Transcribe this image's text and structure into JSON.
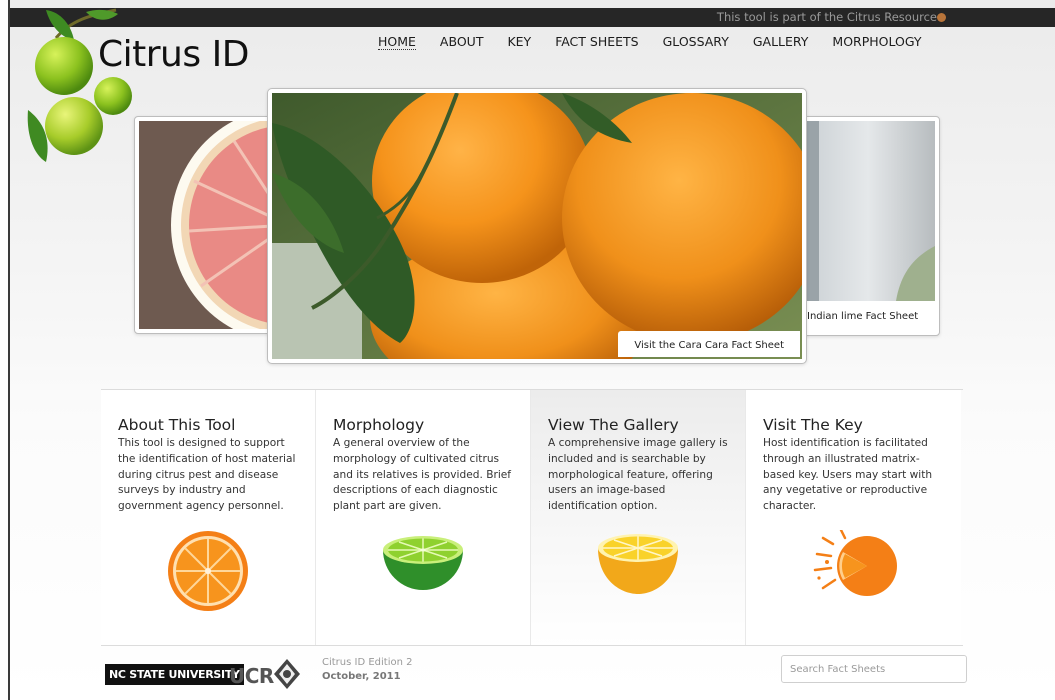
{
  "topbar": {
    "text": "This tool is part of the Citrus Resource"
  },
  "logo": {
    "title": "Citrus ID"
  },
  "nav": {
    "items": [
      "HOME",
      "ABOUT",
      "KEY",
      "FACT SHEETS",
      "GLOSSARY",
      "GALLERY",
      "MORPHOLOGY"
    ],
    "active": "HOME"
  },
  "slideshow": {
    "main_caption": "Visit the Cara Cara Fact Sheet",
    "right_caption": "Indian lime Fact Sheet"
  },
  "features": [
    {
      "title": "About This Tool",
      "body": "This tool is designed to support the identification of host material during citrus pest and disease surveys by industry and government agency personnel.",
      "icon": "orange-slice-icon"
    },
    {
      "title": "Morphology",
      "body": "A general overview of the morphology of cultivated citrus and its relatives is provided. Brief descriptions of each diagnostic plant part are given.",
      "icon": "lime-half-icon"
    },
    {
      "title": "View The Gallery",
      "body": "A comprehensive image gallery is included and is searchable by morphological feature, offering users an image-based identification option.",
      "icon": "lemon-half-icon"
    },
    {
      "title": "Visit The Key",
      "body": "Host identification is facilitated through an illustrated matrix-based key. Users may start with any vegetative or reproductive character.",
      "icon": "orange-splash-icon"
    }
  ],
  "footer": {
    "ncsu": "NC STATE UNIVERSITY",
    "ucr": "UCR",
    "edition_line1": "Citrus ID Edition 2",
    "edition_line2": "October, 2011",
    "search_placeholder": "Search Fact Sheets"
  },
  "colors": {
    "topbar": "#262626",
    "accent_dot": "#b8743a",
    "orange": "#f7941d",
    "lime": "#6cbf2b",
    "lemon": "#f5c518"
  }
}
